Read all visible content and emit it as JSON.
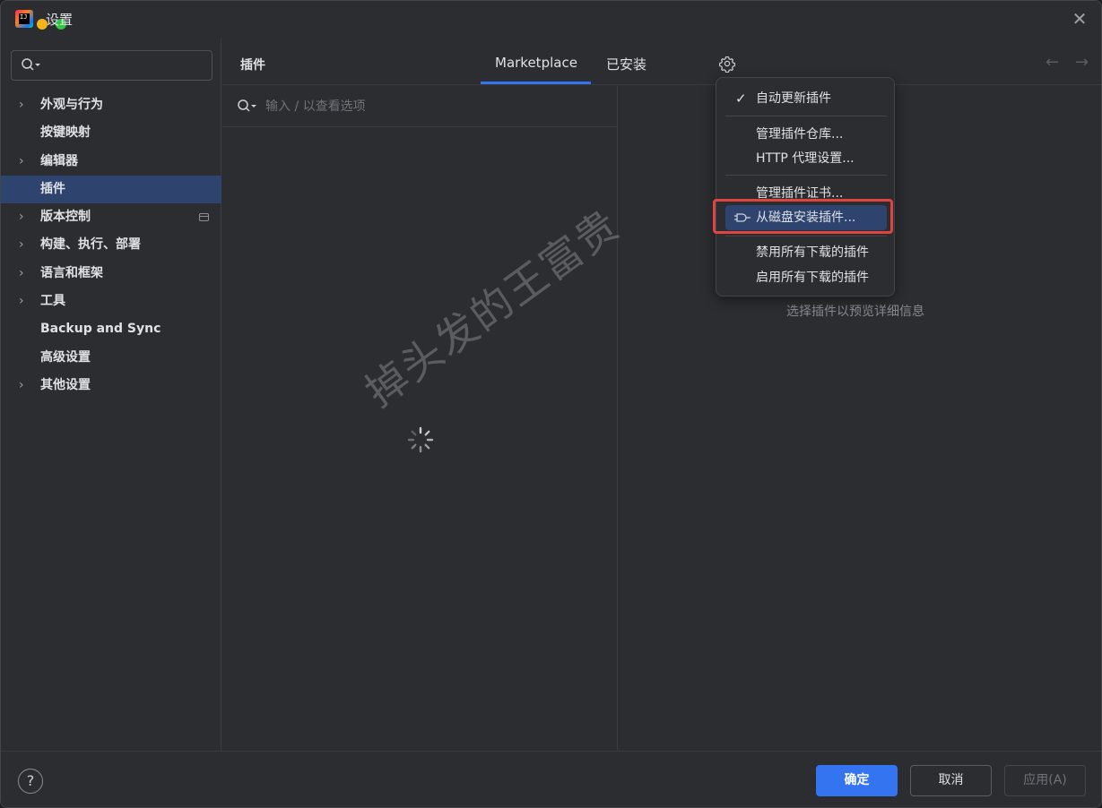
{
  "window": {
    "title": "设置",
    "close": "✕"
  },
  "sidebar": {
    "search_placeholder": "",
    "items": [
      {
        "label": "外观与行为",
        "has_chevron": true
      },
      {
        "label": "按键映射",
        "has_chevron": false
      },
      {
        "label": "编辑器",
        "has_chevron": true
      },
      {
        "label": "插件",
        "has_chevron": false,
        "selected": true
      },
      {
        "label": "版本控制",
        "has_chevron": true,
        "badge_icon": "window-icon"
      },
      {
        "label": "构建、执行、部署",
        "has_chevron": true
      },
      {
        "label": "语言和框架",
        "has_chevron": true
      },
      {
        "label": "工具",
        "has_chevron": true
      },
      {
        "label": "Backup and Sync",
        "has_chevron": false
      },
      {
        "label": "高级设置",
        "has_chevron": false
      },
      {
        "label": "其他设置",
        "has_chevron": true
      }
    ]
  },
  "header": {
    "title": "插件",
    "tabs": [
      {
        "label": "Marketplace",
        "active": true
      },
      {
        "label": "已安装",
        "active": false
      }
    ],
    "back_arrow": "←",
    "forward_arrow": "→"
  },
  "plugin_list": {
    "search_placeholder": "输入 / 以查看选项"
  },
  "detail": {
    "empty_hint": "选择插件以预览详细信息"
  },
  "popup_menu": {
    "items": [
      {
        "label": "自动更新插件",
        "checked": true
      },
      {
        "label": "管理插件仓库..."
      },
      {
        "label": "HTTP 代理设置..."
      },
      {
        "label": "管理插件证书..."
      },
      {
        "label": "从磁盘安装插件...",
        "highlighted": true,
        "icon": "plug-icon"
      },
      {
        "label": "禁用所有下载的插件"
      },
      {
        "label": "启用所有下载的插件"
      }
    ]
  },
  "footer": {
    "help": "?",
    "ok": "确定",
    "cancel": "取消",
    "apply": "应用(A)"
  },
  "watermark": "掉头发的王富贵",
  "colors": {
    "accent": "#3574f0",
    "selection": "#2e436e",
    "annotation_red": "#e0443e",
    "background": "#2b2d30"
  }
}
